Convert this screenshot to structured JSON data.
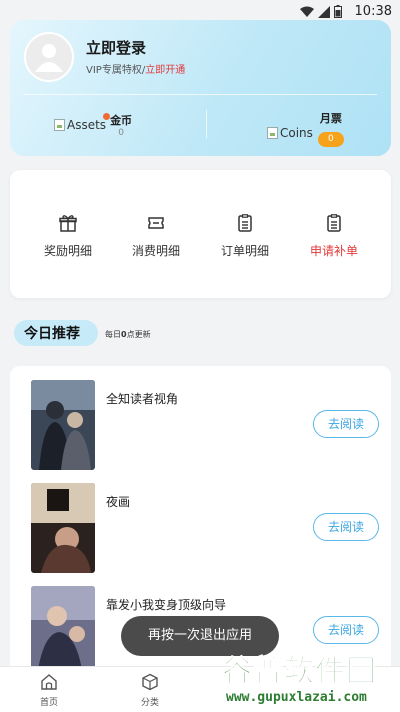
{
  "status_bar": {
    "time": "10:38"
  },
  "user": {
    "login_label": "立即登录",
    "vip_prefix": "VIP专属特权/",
    "vip_action": "立即开通"
  },
  "assets": [
    {
      "img_alt": "Assets",
      "name": "金币",
      "value": "0"
    },
    {
      "img_alt": "Coins",
      "name": "月票",
      "value": "0"
    }
  ],
  "menu": [
    {
      "label": "奖励明细",
      "icon": "gift-icon"
    },
    {
      "label": "消费明细",
      "icon": "ticket-icon"
    },
    {
      "label": "订单明细",
      "icon": "order-list-icon"
    },
    {
      "label": "申请补单",
      "icon": "reissue-list-icon",
      "color": "#e23a3a"
    }
  ],
  "section": {
    "title": "今日推荐",
    "sub_prefix": "每日",
    "sub_bold": "0",
    "sub_suffix": "点更新"
  },
  "books": [
    {
      "title": "全知读者视角",
      "action": "去阅读"
    },
    {
      "title": "夜画",
      "action": "去阅读"
    },
    {
      "title": "靠发小我变身顶级向导",
      "action": "去阅读"
    }
  ],
  "toast": "再按一次退出应用",
  "tabs": [
    {
      "label": "首页",
      "icon": "home-icon"
    },
    {
      "label": "分类",
      "icon": "category-icon"
    }
  ],
  "watermark": {
    "main": "谷普软件园",
    "url": "www.gupuxlazai.com"
  },
  "colors": {
    "accent": "#3aa6e0",
    "red": "#e23a3a",
    "badge": "#f7a21b",
    "card_gradient_end": "#aee2f5"
  }
}
